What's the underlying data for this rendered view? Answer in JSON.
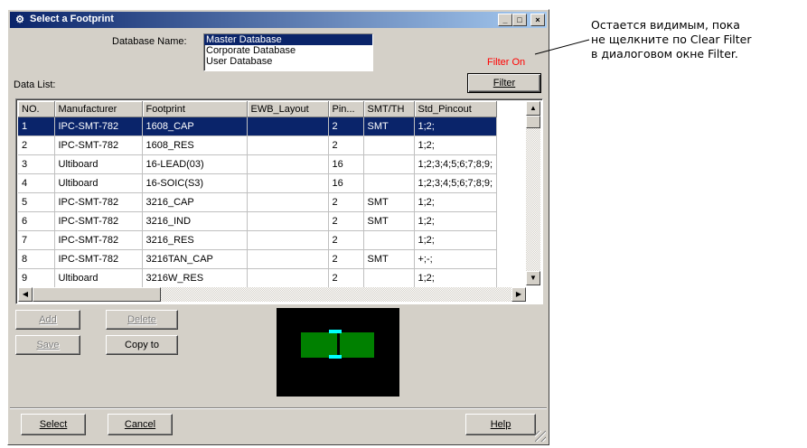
{
  "window": {
    "title": "Select a Footprint",
    "controls": {
      "minimize": "_",
      "maximize": "□",
      "close": "×"
    }
  },
  "database": {
    "label": "Database Name:",
    "options": [
      "Master Database",
      "Corporate Database",
      "User Database"
    ],
    "selected": "Master Database"
  },
  "data_list_label": "Data List:",
  "filter": {
    "status": "Filter On",
    "status_color": "#ff0000",
    "button_label": "Filter"
  },
  "table": {
    "columns": [
      "NO.",
      "Manufacturer",
      "Footprint",
      "EWB_Layout",
      "Pin...",
      "SMT/TH",
      "Std_Pincout"
    ],
    "rows": [
      [
        "1",
        "IPC-SMT-782",
        "1608_CAP",
        "",
        "2",
        "SMT",
        "1;2;"
      ],
      [
        "2",
        "IPC-SMT-782",
        "1608_RES",
        "",
        "2",
        "",
        "1;2;"
      ],
      [
        "3",
        "Ultiboard",
        "16-LEAD(03)",
        "",
        "16",
        "",
        "1;2;3;4;5;6;7;8;9;"
      ],
      [
        "4",
        "Ultiboard",
        "16-SOIC(S3)",
        "",
        "16",
        "",
        "1;2;3;4;5;6;7;8;9;"
      ],
      [
        "5",
        "IPC-SMT-782",
        "3216_CAP",
        "",
        "2",
        "SMT",
        "1;2;"
      ],
      [
        "6",
        "IPC-SMT-782",
        "3216_IND",
        "",
        "2",
        "SMT",
        "1;2;"
      ],
      [
        "7",
        "IPC-SMT-782",
        "3216_RES",
        "",
        "2",
        "",
        "1;2;"
      ],
      [
        "8",
        "IPC-SMT-782",
        "3216TAN_CAP",
        "",
        "2",
        "SMT",
        "+;-;"
      ],
      [
        "9",
        "Ultiboard",
        "3216W_RES",
        "",
        "2",
        "",
        "1;2;"
      ]
    ],
    "selected_row": 0
  },
  "buttons": {
    "add": "Add",
    "delete": "Delete",
    "save": "Save",
    "copy_to": "Copy to",
    "select": "Select",
    "cancel": "Cancel",
    "help": "Help"
  },
  "preview_colors": {
    "background": "#000000",
    "pad": "#008000",
    "pin": "#00ffff"
  },
  "callout": {
    "lines": [
      "Остается видимым, пока",
      "не щелкните по Clear Filter",
      "в диалоговом окне Filter."
    ]
  }
}
